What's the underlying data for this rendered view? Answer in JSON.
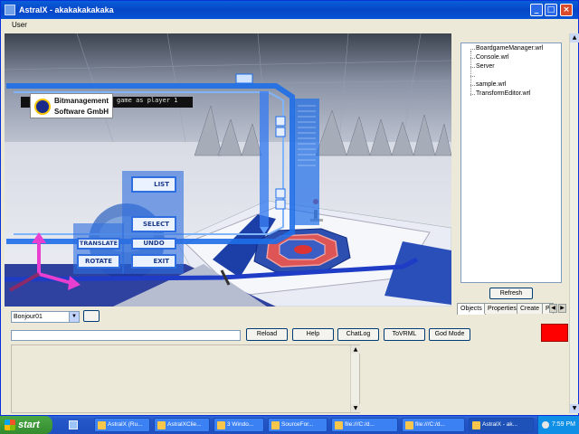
{
  "window": {
    "title": "AstralX - akakakakakaka"
  },
  "titlebar_buttons": {
    "minimize": "_",
    "maximize": "□",
    "close": "×"
  },
  "menu": {
    "items": [
      "User"
    ]
  },
  "viewport": {
    "logo_line1": "Bitmanagement",
    "logo_line2": "Software GmbH",
    "console_text": "game as player 1",
    "buttons": [
      "LIST",
      "SELECT",
      "UNDO",
      "EXIT",
      "TRANSLATE",
      "ROTATE"
    ]
  },
  "tree": {
    "items": [
      "BoardgameManager.wrl",
      "Console.wrl",
      "Server",
      "",
      "sample.wrl",
      "TransformEditor.wrl"
    ]
  },
  "refresh_label": "Refresh",
  "side_tabs": [
    "Objects",
    "Properties",
    "Create",
    "P"
  ],
  "player_select": {
    "value": "Bonjour01"
  },
  "command_buttons": [
    "Reload",
    "Help",
    "ChatLog",
    "ToVRML",
    "God Mode"
  ],
  "colors": {
    "swatch": "#ff0000",
    "accent": "#0a5fd8",
    "viewport_blue": "#1e6ee8"
  },
  "taskbar": {
    "start_label": "start",
    "items": [
      "AstralX (Ru...",
      "AstralXClie...",
      "3 Windo...",
      "SourceFor...",
      "file:///C:/d...",
      "file:///C:/d...",
      "AstralX - ak..."
    ],
    "clock": "7:59 PM"
  }
}
